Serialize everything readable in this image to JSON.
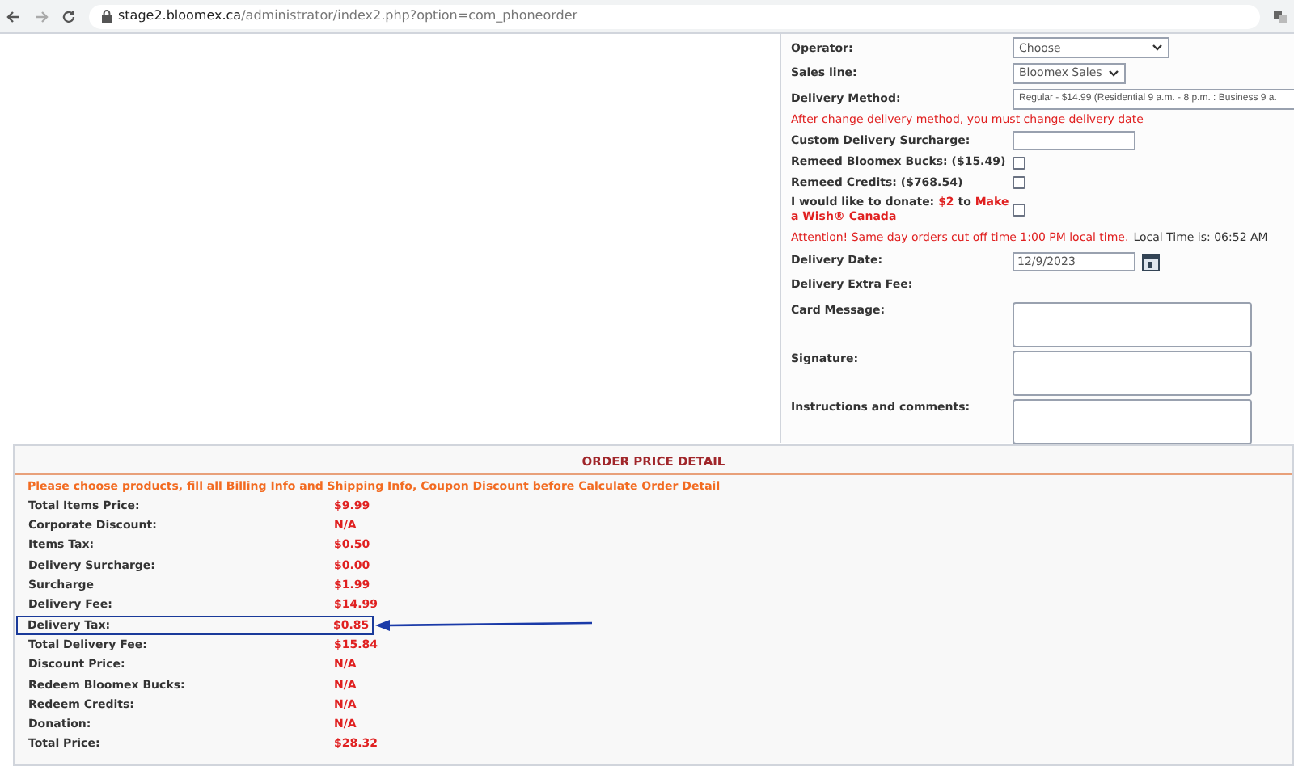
{
  "browser": {
    "url_host": "stage2.bloomex.ca",
    "url_path": "/administrator/index2.php?option=com_phoneorder"
  },
  "form": {
    "rows": [
      {
        "kind": "select",
        "label": "Operator:",
        "value": "Choose"
      },
      {
        "kind": "select",
        "label": "Sales line:",
        "value": "Bloomex Sales"
      },
      {
        "kind": "select",
        "label": "Delivery Method:",
        "value": "Regular - $14.99 (Residential 9 a.m. - 8 p.m. : Business 9 a."
      },
      {
        "kind": "note",
        "text": "After change delivery method, you must change delivery date"
      },
      {
        "kind": "text",
        "label": "Custom Delivery Surcharge:"
      },
      {
        "kind": "checkbox",
        "label": "Remeed Bloomex Bucks: ($15.49)",
        "checked": false
      },
      {
        "kind": "checkbox",
        "label": "Remeed Credits: ($768.54)",
        "checked": false
      },
      {
        "kind": "donate",
        "label": "I would like to donate:",
        "amount": "$2",
        "joiner": "to",
        "charity": "Make a Wish® Canada",
        "checked": false
      },
      {
        "kind": "attention",
        "text": "Attention! Same day orders cut off time 1:00 PM local time.",
        "extra": "Local Time is: 06:52 AM"
      },
      {
        "kind": "date",
        "label": "Delivery Date:",
        "value": "12/9/2023"
      },
      {
        "kind": "plain",
        "label": "Delivery Extra Fee:"
      },
      {
        "kind": "textarea",
        "label": "Card Message:"
      },
      {
        "kind": "textarea",
        "label": "Signature:"
      },
      {
        "kind": "textarea",
        "label": "Instructions and comments:"
      }
    ]
  },
  "order_price_detail": {
    "title": "ORDER PRICE DETAIL",
    "notice": "Please choose products, fill all Billing Info and Shipping Info, Coupon Discount before Calculate Order Detail",
    "rows": [
      {
        "label": "Total Items Price:",
        "value": "$9.99",
        "highlighted": false
      },
      {
        "label": "Corporate Discount:",
        "value": "N/A",
        "highlighted": false
      },
      {
        "label": "Items Tax:",
        "value": "$0.50",
        "highlighted": false
      },
      {
        "label": "Delivery Surcharge:",
        "value": "$0.00",
        "highlighted": false
      },
      {
        "label": "Surcharge",
        "value": "$1.99",
        "highlighted": false
      },
      {
        "label": "Delivery Fee:",
        "value": "$14.99",
        "highlighted": false
      },
      {
        "label": "Delivery Tax:",
        "value": "$0.85",
        "highlighted": true
      },
      {
        "label": "Total Delivery Fee:",
        "value": "$15.84",
        "highlighted": false
      },
      {
        "label": "Discount Price:",
        "value": "N/A",
        "highlighted": false
      },
      {
        "label": "Redeem Bloomex Bucks:",
        "value": "N/A",
        "highlighted": false
      },
      {
        "label": "Redeem Credits:",
        "value": "N/A",
        "highlighted": false
      },
      {
        "label": "Donation:",
        "value": "N/A",
        "highlighted": false
      },
      {
        "label": "Total Price:",
        "value": "$28.32",
        "highlighted": false
      }
    ]
  }
}
